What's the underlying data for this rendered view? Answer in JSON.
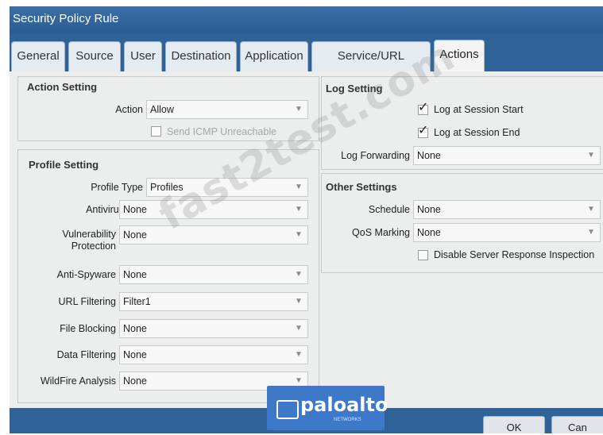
{
  "dialog": {
    "title": "Security Policy Rule"
  },
  "tabs": [
    {
      "label": "General"
    },
    {
      "label": "Source"
    },
    {
      "label": "User"
    },
    {
      "label": "Destination"
    },
    {
      "label": "Application"
    },
    {
      "label": "Service/URL Category"
    },
    {
      "label": "Actions",
      "active": true
    }
  ],
  "action_setting": {
    "title": "Action Setting",
    "action_label": "Action",
    "action_value": "Allow",
    "icmp_label": "Send ICMP Unreachable",
    "icmp_checked": false
  },
  "profile_setting": {
    "title": "Profile Setting",
    "fields": [
      {
        "label": "Profile Type",
        "value": "Profiles"
      },
      {
        "label": "Antivirus",
        "value": "None"
      },
      {
        "label": "Vulnerability",
        "label2": "Protection",
        "value": "None"
      },
      {
        "label": "Anti-Spyware",
        "value": "None"
      },
      {
        "label": "URL Filtering",
        "value": "Filter1"
      },
      {
        "label": "File Blocking",
        "value": "None"
      },
      {
        "label": "Data Filtering",
        "value": "None"
      },
      {
        "label": "WildFire Analysis",
        "value": "None"
      }
    ]
  },
  "log_setting": {
    "title": "Log Setting",
    "log_start_label": "Log at Session Start",
    "log_start_checked": true,
    "log_end_label": "Log at Session End",
    "log_end_checked": true,
    "forwarding_label": "Log Forwarding",
    "forwarding_value": "None"
  },
  "other_settings": {
    "title": "Other Settings",
    "schedule_label": "Schedule",
    "schedule_value": "None",
    "qos_label": "QoS Marking",
    "qos_value": "None",
    "dsri_label": "Disable Server Response Inspection",
    "dsri_checked": false
  },
  "footer": {
    "ok_label": "OK",
    "cancel_label": "Can"
  },
  "overlays": {
    "watermark": "fast2test.com",
    "badge_text": "paloalto",
    "badge_sub": "NETWORKS"
  },
  "icons": {
    "dropdown": "chevron-down-icon",
    "check": "checkmark-icon"
  }
}
